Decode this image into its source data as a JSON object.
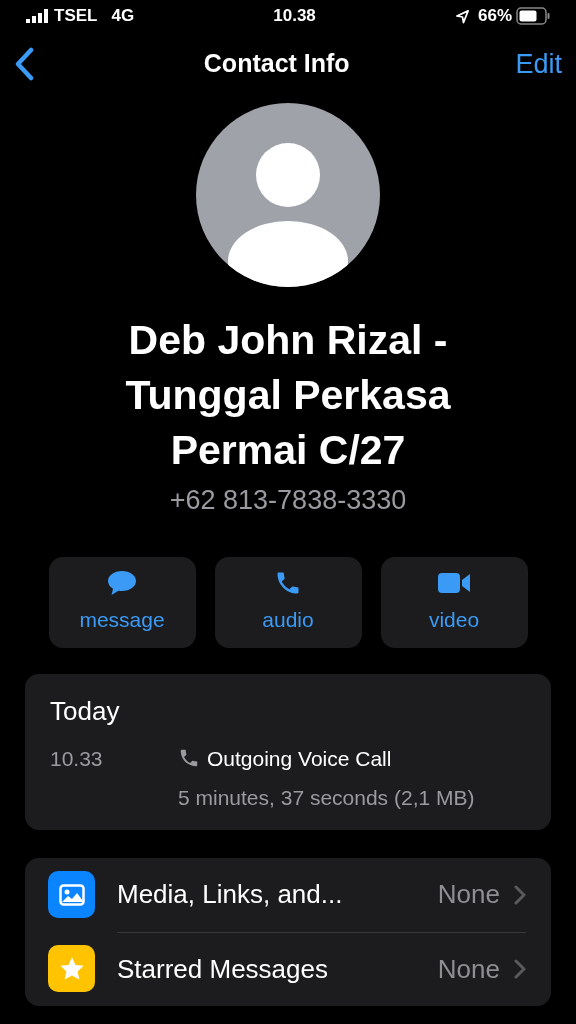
{
  "status_bar": {
    "carrier": "TSEL",
    "network": "4G",
    "time": "10.38",
    "battery": "66%"
  },
  "nav": {
    "title": "Contact Info",
    "action": "Edit"
  },
  "contact": {
    "name": "Deb John Rizal - Tunggal Perkasa Permai C/27",
    "phone": "+62 813-7838-3330"
  },
  "actions": [
    {
      "kind": "message",
      "label": "message"
    },
    {
      "kind": "audio",
      "label": "audio"
    },
    {
      "kind": "video",
      "label": "video"
    }
  ],
  "call_log": {
    "heading": "Today",
    "entries": [
      {
        "time": "10.33",
        "type": "Outgoing Voice Call",
        "detail": "5 minutes, 37 seconds (2,1 MB)"
      }
    ]
  },
  "rows": [
    {
      "kind": "media",
      "label": "Media, Links, and...",
      "value": "None",
      "color": "#0a84ff"
    },
    {
      "kind": "starred",
      "label": "Starred Messages",
      "value": "None",
      "color": "#ffc300"
    }
  ]
}
